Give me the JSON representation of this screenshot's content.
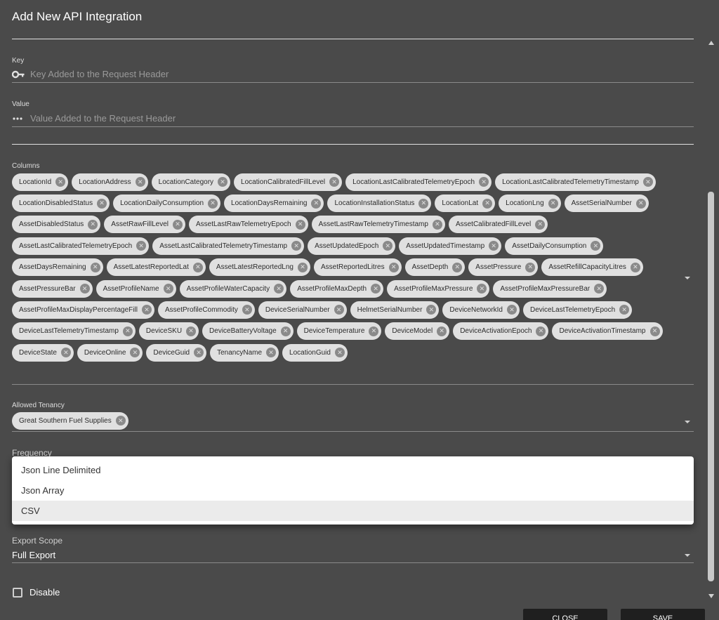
{
  "dialog": {
    "title": "Add New API Integration"
  },
  "key_field": {
    "label": "Key",
    "placeholder": "Key Added to the Request Header",
    "value": ""
  },
  "value_field": {
    "label": "Value",
    "placeholder": "Value Added to the Request Header",
    "value": ""
  },
  "columns": {
    "label": "Columns",
    "chips": [
      "LocationId",
      "LocationAddress",
      "LocationCategory",
      "LocationCalibratedFillLevel",
      "LocationLastCalibratedTelemetryEpoch",
      "LocationLastCalibratedTelemetryTimestamp",
      "LocationDisabledStatus",
      "LocationDailyConsumption",
      "LocationDaysRemaining",
      "LocationInstallationStatus",
      "LocationLat",
      "LocationLng",
      "AssetSerialNumber",
      "AssetDisabledStatus",
      "AssetRawFillLevel",
      "AssetLastRawTelemetryEpoch",
      "AssetLastRawTelemetryTimestamp",
      "AssetCalibratedFillLevel",
      "AssetLastCalibratedTelemetryEpoch",
      "AssetLastCalibratedTelemetryTimestamp",
      "AssetUpdatedEpoch",
      "AssetUpdatedTimestamp",
      "AssetDailyConsumption",
      "AssetDaysRemaining",
      "AssetLatestReportedLat",
      "AssetLatestReportedLng",
      "AssetReportedLitres",
      "AssetDepth",
      "AssetPressure",
      "AssetRefillCapacityLitres",
      "AssetPressureBar",
      "AssetProfileName",
      "AssetProfileWaterCapacity",
      "AssetProfileMaxDepth",
      "AssetProfileMaxPressure",
      "AssetProfileMaxPressureBar",
      "AssetProfileMaxDisplayPercentageFill",
      "AssetProfileCommodity",
      "DeviceSerialNumber",
      "HelmetSerialNumber",
      "DeviceNetworkId",
      "DeviceLastTelemetryEpoch",
      "DeviceLastTelemetryTimestamp",
      "DeviceSKU",
      "DeviceBatteryVoltage",
      "DeviceTemperature",
      "DeviceModel",
      "DeviceActivationEpoch",
      "DeviceActivationTimestamp",
      "DeviceState",
      "DeviceOnline",
      "DeviceGuid",
      "TenancyName",
      "LocationGuid"
    ]
  },
  "allowed_tenancy": {
    "label": "Allowed Tenancy",
    "chips": [
      "Great Southern Fuel Supplies"
    ]
  },
  "frequency": {
    "label": "Frequency"
  },
  "format_dropdown": {
    "options": [
      "Json Line Delimited",
      "Json Array",
      "CSV"
    ],
    "selected": "CSV"
  },
  "export_scope": {
    "label": "Export Scope",
    "value": "Full Export"
  },
  "disable": {
    "label": "Disable",
    "checked": false
  },
  "actions": {
    "close": "CLOSE",
    "save": "SAVE"
  }
}
